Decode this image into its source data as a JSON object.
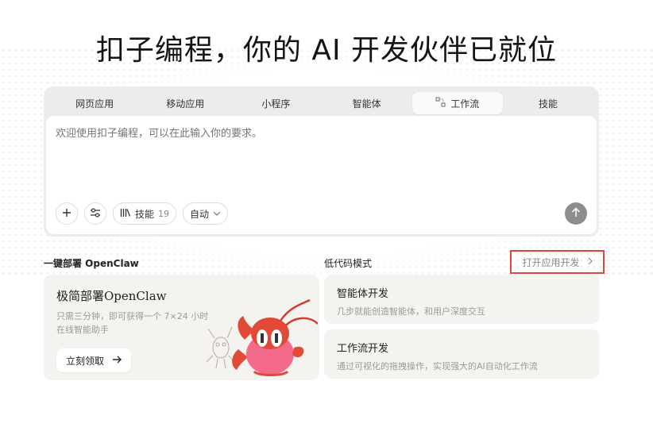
{
  "headline": "扣子编程，你的 AI 开发伙伴已就位",
  "tabs": [
    {
      "label": "网页应用"
    },
    {
      "label": "移动应用"
    },
    {
      "label": "小程序"
    },
    {
      "label": "智能体"
    },
    {
      "label": "工作流"
    },
    {
      "label": "技能"
    }
  ],
  "composer": {
    "placeholder": "欢迎使用扣子编程，可以在此输入你的要求。",
    "skills_label": "技能",
    "skills_count": "19",
    "mode_label": "自动"
  },
  "sections": {
    "left_title": "一键部署 OpenClaw",
    "right_title": "低代码模式",
    "open_link": "打开应用开发"
  },
  "promo": {
    "title": "极简部署OpenClaw",
    "desc": "只需三分钟，即可获得一个 7×24 小时在线智能助手",
    "button": "立刻领取"
  },
  "cards": [
    {
      "title": "智能体开发",
      "desc": "几步就能创造智能体，和用户深度交互"
    },
    {
      "title": "工作流开发",
      "desc": "通过可视化的拖拽操作，实现强大的AI自动化工作流"
    }
  ],
  "colors": {
    "highlight_border": "#e0453d",
    "send_button": "#8d8d8d"
  }
}
